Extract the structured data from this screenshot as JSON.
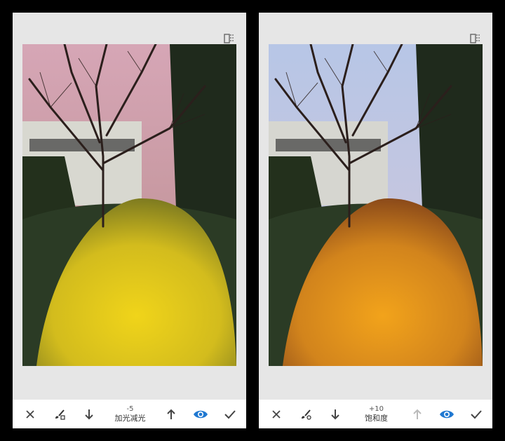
{
  "panels": [
    {
      "id": "left",
      "toolbar": {
        "value": "-5",
        "label": "加光减光",
        "up_enabled": true
      },
      "colors": {
        "sky_top": "#d6a6b6",
        "sky_bottom": "#b98c8c",
        "flowers": "#f0d41a",
        "flowers_shadow": "#7e7b20"
      }
    },
    {
      "id": "right",
      "toolbar": {
        "value": "+10",
        "label": "饱和度",
        "up_enabled": false
      },
      "colors": {
        "sky_top": "#b7c6e6",
        "sky_bottom": "#d2c7da",
        "flowers": "#f2a31b",
        "flowers_shadow": "#8b4a1a"
      }
    }
  ],
  "icons": {
    "cancel": "close-icon",
    "brush": "brush-icon",
    "down": "arrow-down-icon",
    "up": "arrow-up-icon",
    "eye": "eye-icon",
    "check": "check-icon",
    "compare": "compare-icon"
  },
  "accent": "#1f78d1"
}
